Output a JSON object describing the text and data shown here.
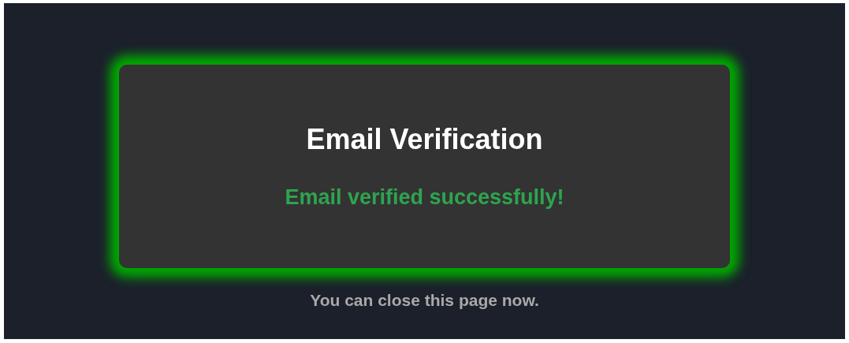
{
  "card": {
    "title": "Email Verification",
    "status": {
      "kind": "success",
      "text": "Email verified successfully!"
    }
  },
  "footer": "You can close this page now."
}
